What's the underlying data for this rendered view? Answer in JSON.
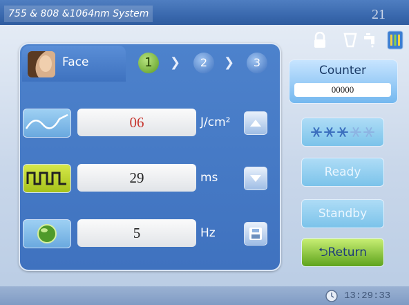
{
  "title_bar": {
    "title": "755 & 808 &1064nm System",
    "screen_number": "21"
  },
  "status_icons": [
    "lock-icon",
    "cup-icon",
    "faucet-icon",
    "battery-icon"
  ],
  "mode_tab": {
    "label": "Face"
  },
  "steps": [
    {
      "label": "1"
    },
    {
      "label": "2"
    },
    {
      "label": "3"
    }
  ],
  "parameters": {
    "energy": {
      "value": "06",
      "unit": "J/cm²",
      "icon": "waveform-icon"
    },
    "pulse": {
      "value": "29",
      "unit": "ms",
      "icon": "square-pulse-icon"
    },
    "frequency": {
      "value": "5",
      "unit": "Hz",
      "icon": "green-sphere-icon"
    }
  },
  "controls": {
    "up": "arrow-up-icon",
    "down": "arrow-down-icon",
    "save": "save-icon"
  },
  "counter": {
    "label": "Counter",
    "value": "00000"
  },
  "cooling": {
    "icon": "snowflake-icon",
    "count": 5
  },
  "buttons": {
    "ready": "Ready",
    "standby": "Standby",
    "return": "Return"
  },
  "bottom": {
    "time": "13:29:33"
  },
  "colors": {
    "energy_value": "#c7352e",
    "accent_green": "#5ea31c",
    "panel_blue": "#3f72bf"
  }
}
